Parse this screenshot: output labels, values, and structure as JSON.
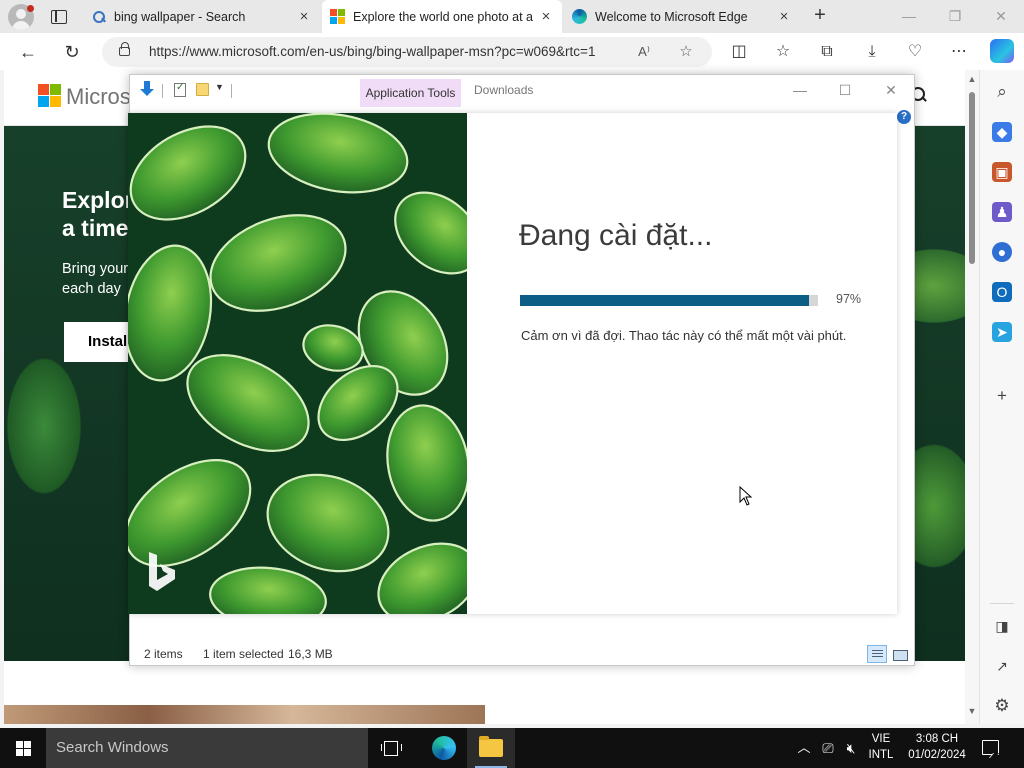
{
  "browser": {
    "tabs": [
      {
        "title": "bing wallpaper - Search",
        "favicon": "search-icon",
        "active": false
      },
      {
        "title": "Explore the world one photo at a",
        "favicon": "microsoft-logo",
        "active": true
      },
      {
        "title": "Welcome to Microsoft Edge",
        "favicon": "edge-icon",
        "active": false
      }
    ],
    "close_glyph": "×",
    "url": "https://www.microsoft.com/en-us/bing/bing-wallpaper-msn?pc=w069&rtc=1",
    "window_controls": {
      "minimize": "—",
      "restore": "❐",
      "close": "✕"
    }
  },
  "webpage": {
    "brand": "Microsoft",
    "hero_title_line1": "Explore the world",
    "hero_title_line2": "a time",
    "hero_text_line1": "Bring your",
    "hero_text_line2": "each day",
    "install_button": "Install"
  },
  "explorer": {
    "context_tab": "Application Tools",
    "title": "Downloads",
    "window_controls": {
      "minimize": "—",
      "maximize": "☐",
      "close": "✕"
    },
    "help": "?",
    "status": {
      "item_count": "2 items",
      "selected": "1 item selected",
      "size": "16,3 MB"
    }
  },
  "installer": {
    "heading": "Đang cài đặt...",
    "progress": 97,
    "progress_label": "97%",
    "note": "Cảm ơn vì đã đợi. Thao tác này có thể mất một vài phút.",
    "progress_color": "#0c5e86"
  },
  "taskbar": {
    "search_placeholder": "Search Windows",
    "language_line1": "VIE",
    "language_line2": "INTL",
    "time": "3:08 CH",
    "date": "01/02/2024"
  }
}
